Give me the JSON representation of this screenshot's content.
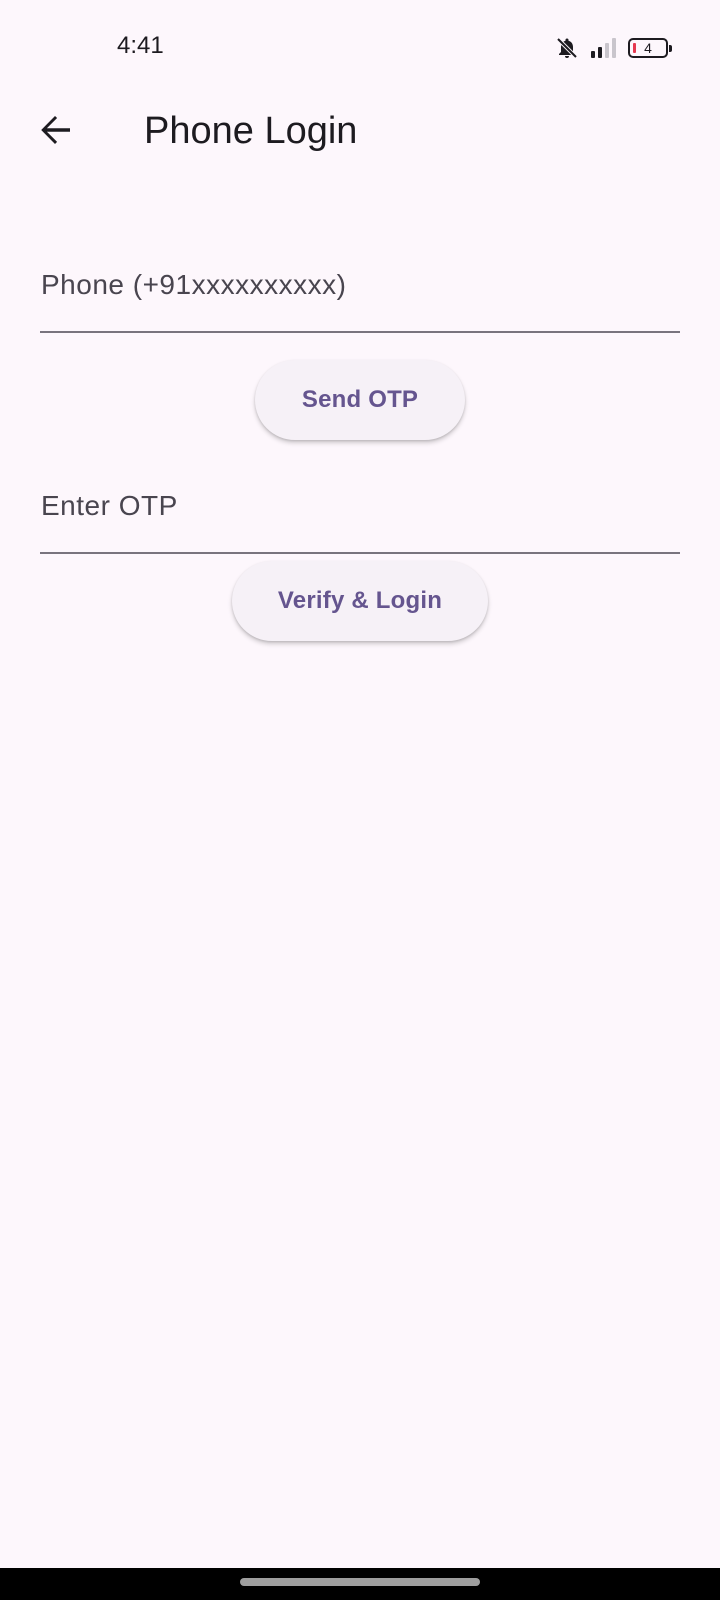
{
  "status_bar": {
    "time": "4:41",
    "battery_level": "4",
    "icons": [
      "bell-off-icon",
      "signal-icon",
      "battery-icon"
    ]
  },
  "app_bar": {
    "back_icon": "arrow-left-icon",
    "title": "Phone Login"
  },
  "form": {
    "phone_label": "Phone (+91xxxxxxxxxx)",
    "phone_value": "",
    "send_otp_label": "Send OTP",
    "otp_label": "Enter OTP",
    "otp_value": "",
    "verify_label": "Verify & Login"
  },
  "colors": {
    "background": "#fdf7fc",
    "accent": "#65558f",
    "button_surface": "#f6f1f7",
    "field_underline": "#79747e"
  }
}
